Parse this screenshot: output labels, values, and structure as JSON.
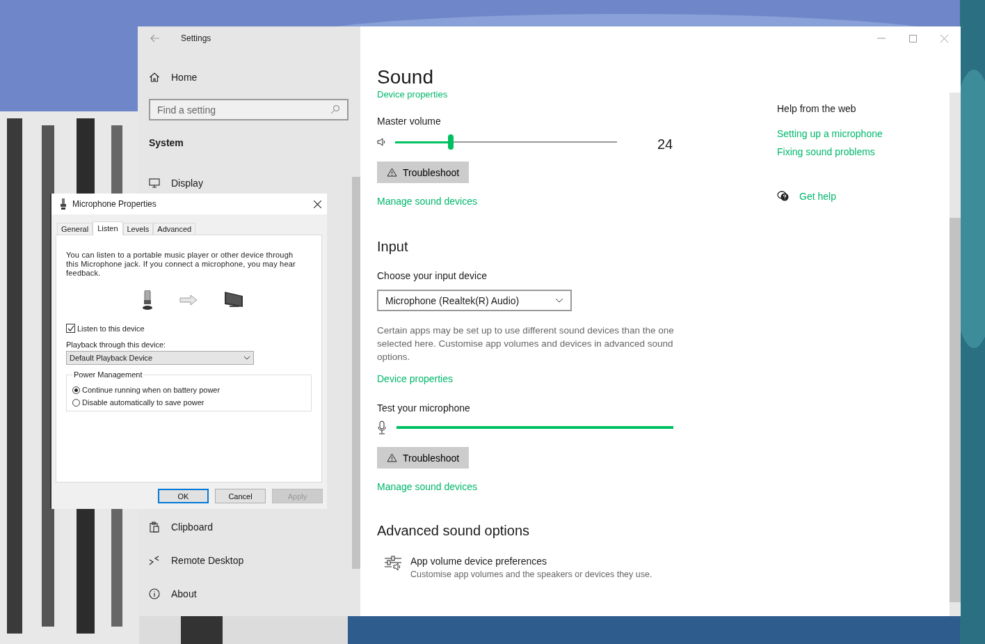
{
  "settings": {
    "title": "Settings",
    "sidebar": {
      "home": "Home",
      "search": {
        "placeholder": "Find a setting"
      },
      "section": "System",
      "items_top": [
        {
          "label": "Display"
        }
      ],
      "items_bottom": [
        {
          "label": "Clipboard"
        },
        {
          "label": "Remote Desktop"
        },
        {
          "label": "About"
        }
      ]
    },
    "main": {
      "title": "Sound",
      "cut_link": "Device properties",
      "output": {
        "label": "Master volume",
        "level": 0.25,
        "value": "24",
        "troubleshoot": "Troubleshoot",
        "manage_link": "Manage sound devices"
      },
      "input": {
        "heading": "Input",
        "device_label": "Choose your input device",
        "device": "Microphone (Realtek(R) Audio)",
        "note": "Certain apps may be set up to use different sound devices than the one selected here. Customise app volumes and devices in advanced sound options.",
        "properties_link": "Device properties",
        "test_label": "Test your microphone",
        "level": 1.0,
        "troubleshoot": "Troubleshoot",
        "manage_link": "Manage sound devices"
      },
      "advanced": {
        "heading": "Advanced sound options",
        "item_title": "App volume  device preferences",
        "item_desc": "Customise app volumes and the speakers or devices they use."
      },
      "help": {
        "heading": "Help from the web",
        "links": [
          "Setting up a microphone",
          "Fixing sound problems"
        ],
        "get_help": "Get help"
      }
    }
  },
  "dialog": {
    "title": "Microphone Properties",
    "tabs": [
      {
        "label": "General",
        "selected": false
      },
      {
        "label": "Listen",
        "selected": true
      },
      {
        "label": "Levels",
        "selected": false
      },
      {
        "label": "Advanced",
        "selected": false
      }
    ],
    "description": "You can listen to a portable music player or other device through this Microphone jack. If you connect a microphone, you may hear feedback.",
    "listen": {
      "label": "Listen to this device",
      "checked": true
    },
    "playback_label": "Playback through this device:",
    "playback_device": "Default Playback Device",
    "power": {
      "title": "Power Management",
      "options": [
        {
          "label": "Continue running when on battery power",
          "selected": true
        },
        {
          "label": "Disable automatically to save power",
          "selected": false
        }
      ]
    },
    "buttons": [
      {
        "label": "OK",
        "default": true,
        "disabled": false
      },
      {
        "label": "Cancel",
        "default": false,
        "disabled": false
      },
      {
        "label": "Apply",
        "default": false,
        "disabled": true
      }
    ]
  }
}
